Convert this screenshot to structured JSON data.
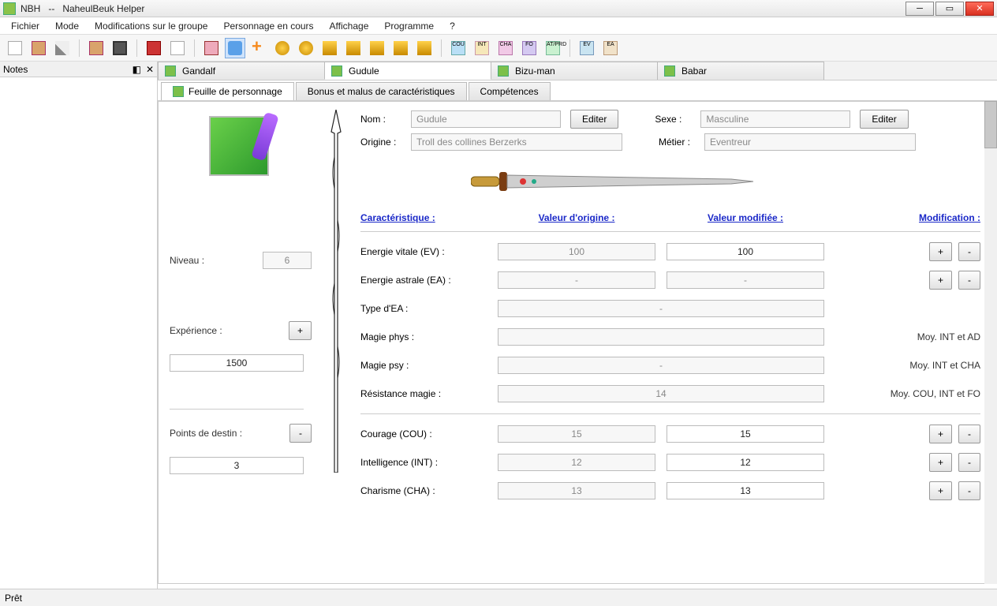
{
  "window": {
    "app_short": "NBH",
    "sep": "--",
    "app_name": "NaheulBeuk Helper"
  },
  "menu": {
    "fichier": "Fichier",
    "mode": "Mode",
    "modif_groupe": "Modifications sur le groupe",
    "perso_en_cours": "Personnage en cours",
    "affichage": "Affichage",
    "programme": "Programme",
    "help": "?"
  },
  "notes": {
    "title": "Notes"
  },
  "tabs": {
    "gandalf": "Gandalf",
    "gudule": "Gudule",
    "bizuman": "Bizu-man",
    "babar": "Babar"
  },
  "subtabs": {
    "feuille": "Feuille de personnage",
    "bonus": "Bonus et malus de caractéristiques",
    "comp": "Compétences"
  },
  "form": {
    "nom_label": "Nom :",
    "nom_value": "Gudule",
    "editer": "Editer",
    "sexe_label": "Sexe :",
    "sexe_value": "Masculine",
    "origine_label": "Origine :",
    "origine_value": "Troll des collines Berzerks",
    "metier_label": "Métier :",
    "metier_value": "Eventreur",
    "niveau_label": "Niveau :",
    "niveau_value": "6",
    "exp_label": "Expérience :",
    "exp_value": "1500",
    "destin_label": "Points de destin :",
    "destin_value": "3"
  },
  "headers": {
    "carac": "Caractéristique :",
    "val_origine": "Valeur d'origine :",
    "val_mod": "Valeur modifiée :",
    "modif": "Modification :"
  },
  "stats": {
    "ev_label": "Energie vitale (EV) :",
    "ev_o": "100",
    "ev_m": "100",
    "ea_label": "Energie astrale (EA) :",
    "ea_o": "-",
    "ea_m": "-",
    "type_ea_label": "Type d'EA :",
    "type_ea_o": "-",
    "mphys_label": "Magie phys :",
    "mphys_note": "Moy. INT et AD",
    "mpsy_label": "Magie psy :",
    "mpsy_o": "-",
    "mpsy_note": "Moy. INT et CHA",
    "res_label": "Résistance magie :",
    "res_o": "14",
    "res_note": "Moy. COU, INT et FO",
    "cou_label": "Courage (COU) :",
    "cou_o": "15",
    "cou_m": "15",
    "int_label": "Intelligence (INT) :",
    "int_o": "12",
    "int_m": "12",
    "cha_label": "Charisme (CHA) :",
    "cha_o": "13",
    "cha_m": "13"
  },
  "buttons": {
    "plus": "+",
    "minus": "-"
  },
  "status": {
    "ready": "Prêt"
  }
}
